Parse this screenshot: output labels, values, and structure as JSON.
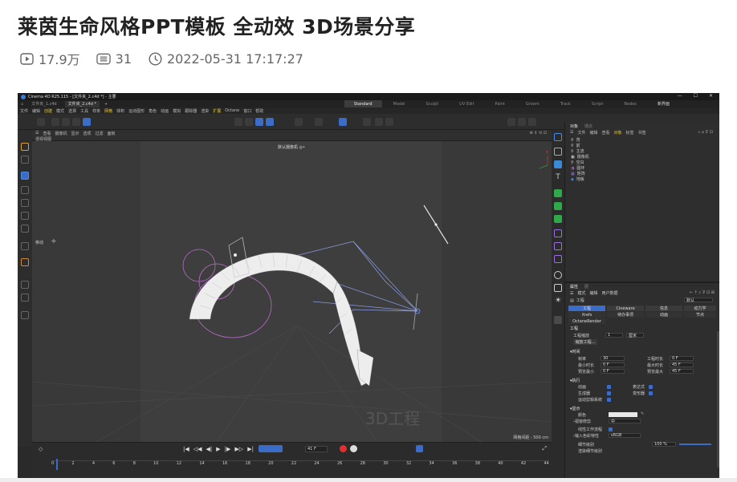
{
  "header": {
    "title": "莱茵生命风格PPT模板 全动效 3D场景分享",
    "views": "17.9万",
    "comments": "31",
    "datetime": "2022-05-31 17:17:27"
  },
  "c4d": {
    "window_title": "Cinema 4D R25.115 - [文件夹_2.c4d *] - 主要",
    "doc_tabs": [
      "文件夹_1.c4d",
      "文件夹_2.c4d *"
    ],
    "layouts": [
      "Standard",
      "Model",
      "Sculpt",
      "UV Edit",
      "Paint",
      "Groom",
      "Track",
      "Script",
      "Nodes"
    ],
    "layout_extra": "新界面",
    "menus": [
      "文件",
      "编辑",
      "创建",
      "模式",
      "选择",
      "工具",
      "样条",
      "网格",
      "体积",
      "运动图形",
      "角色",
      "动画",
      "模拟",
      "跟踪器",
      "渲染",
      "扩展",
      "Octane",
      "窗口",
      "帮助"
    ],
    "viewport": {
      "menus": [
        "查看",
        "摄像机",
        "显示",
        "选项",
        "过滤",
        "面板"
      ],
      "view_label": "透视视图",
      "camera_label": "默认摄像机 ◎•",
      "move_label": "移动",
      "watermark": "3D工程",
      "grid_info": "网格间距 : 500 cm"
    },
    "timeline": {
      "frame": "41 F",
      "ticks": [
        "0",
        "2",
        "4",
        "6",
        "8",
        "10",
        "12",
        "14",
        "16",
        "18",
        "20",
        "22",
        "24",
        "26",
        "28",
        "30",
        "32",
        "34",
        "36",
        "38",
        "40",
        "42",
        "44"
      ]
    },
    "objects_panel": {
      "tabs": [
        "对象",
        "场次"
      ],
      "menus": [
        "文件",
        "编辑",
        "查看",
        "对象",
        "标签",
        "书签"
      ],
      "items": [
        "背",
        "前",
        "主流",
        "摄像机",
        "空白",
        "圆环",
        "矩阵",
        "地板"
      ]
    },
    "attributes": {
      "tabs": [
        "属性",
        "层"
      ],
      "menus": [
        "模式",
        "编辑",
        "用户数据"
      ],
      "title": "工程",
      "preset": "默认",
      "tab_row1": [
        "工程",
        "Cineware",
        "信息",
        "动力学"
      ],
      "tab_row2": [
        "Xrefs",
        "待办事项",
        "动画",
        "节点"
      ],
      "octane": "OctaneRender",
      "section": "工程",
      "scale_label": "工程缩放",
      "scale_value": "1",
      "scale_unit": "厘米",
      "scale_btn": "缩放工程...",
      "time_header": "时间",
      "fps_label": "帧率",
      "fps_value": "30",
      "project_time_label": "工程时长",
      "project_time_value": "0 F",
      "min_time_label": "最小时长",
      "min_time_value": "0 F",
      "max_time_label": "最大时长",
      "max_time_value": "45 F",
      "preview_min_label": "预览最小",
      "preview_min_value": "0 F",
      "preview_max_label": "预览最大",
      "preview_max_value": "45 F",
      "exec_header": "执行",
      "anim_label": "动画",
      "expr_label": "表达式",
      "gen_label": "生成器",
      "deform_label": "变形器",
      "motion_label": "运动剪辑系统",
      "display_header": "显示",
      "color_label": "颜色",
      "view_clip_label": "视窗修剪",
      "view_clip_value": "中",
      "linear_label": "线性工作流程",
      "input_color_label": "输入色彩特性",
      "input_color_value": "sRGB",
      "lod_label": "细节级别",
      "lod_value": "100 %",
      "render_lod_label": "渲染细节级别"
    }
  }
}
